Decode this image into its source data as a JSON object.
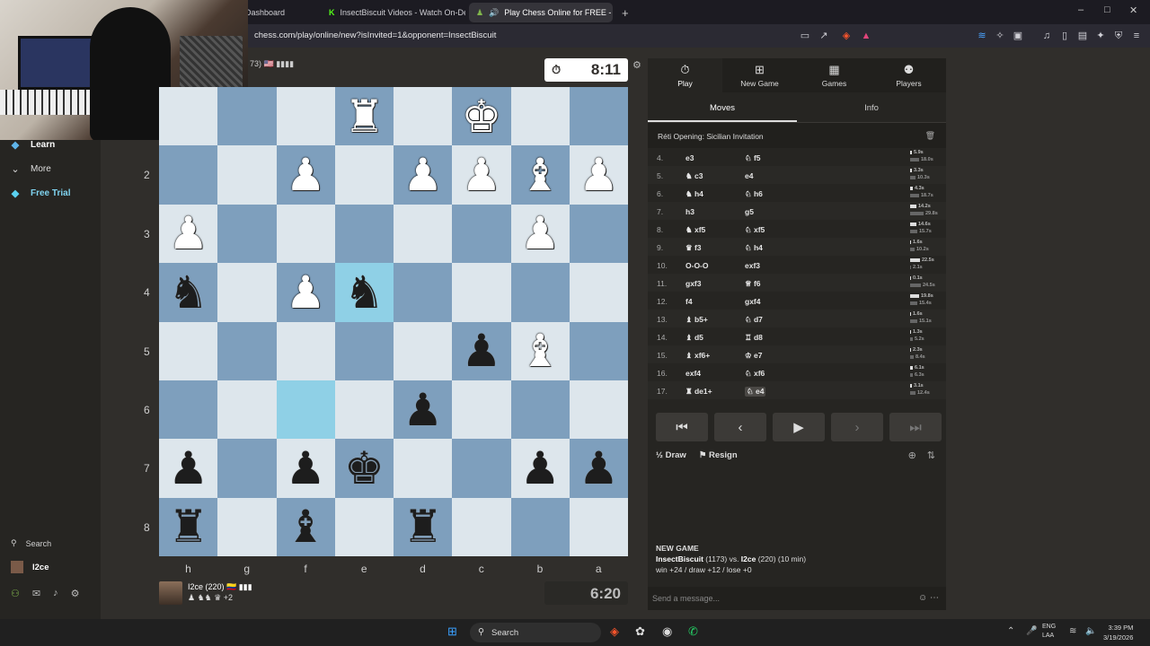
{
  "browser": {
    "tabs": [
      {
        "label": "Dashboard",
        "active": false
      },
      {
        "label": "InsectBiscuit Videos - Watch On-Dem",
        "active": false
      },
      {
        "label": "Play Chess Online for FREE - ",
        "active": true
      }
    ],
    "new_tab_glyph": "+",
    "url": "chess.com/play/online/new?isInvited=1&opponent=InsectBiscuit",
    "window_controls": [
      "–",
      "□",
      "✕"
    ]
  },
  "sidebar": {
    "items": [
      {
        "label": "Learn",
        "icon": "learn-icon"
      },
      {
        "label": "More",
        "icon": "chevron-down-icon"
      },
      {
        "label": "Free Trial",
        "icon": "diamond-icon"
      }
    ],
    "search_label": "Search",
    "username": "I2ce"
  },
  "top_player": {
    "info": "73) 🇺🇸 ▮▮▮▮",
    "clock": "8:11"
  },
  "board": {
    "rank_labels": [
      "2",
      "3",
      "4",
      "5",
      "6",
      "7",
      "8"
    ],
    "file_labels": [
      "h",
      "g",
      "f",
      "e",
      "d",
      "c",
      "b",
      "a"
    ],
    "rows": [
      [
        "",
        "",
        "",
        "wR",
        "",
        "wK",
        "",
        ""
      ],
      [
        "",
        "",
        "wP",
        "",
        "wP",
        "wP",
        "wB",
        "wP"
      ],
      [
        "wP",
        "",
        "",
        "",
        "",
        "",
        "wP",
        ""
      ],
      [
        "bN",
        "",
        "wP",
        "bN",
        "",
        "",
        "",
        ""
      ],
      [
        "",
        "",
        "",
        "",
        "",
        "bP",
        "wB",
        ""
      ],
      [
        "",
        "",
        "",
        "",
        "bP",
        "",
        "",
        ""
      ],
      [
        "bP",
        "",
        "bP",
        "bK",
        "",
        "",
        "bP",
        "bP"
      ],
      [
        "bR",
        "",
        "bB",
        "",
        "bR",
        "",
        "",
        ""
      ]
    ],
    "highlighted": [
      "3,3",
      "5,2"
    ]
  },
  "bottom_player": {
    "name": "I2ce (220) 🇨🇴 ▮▮▮",
    "captures": "♟ ♞♞ ♛ +2",
    "clock": "6:20"
  },
  "panel": {
    "tabs": [
      {
        "label": "Play",
        "icon": "stopwatch-icon",
        "active": true
      },
      {
        "label": "New Game",
        "icon": "plus-icon",
        "active": false
      },
      {
        "label": "Games",
        "icon": "board-icon",
        "active": false
      },
      {
        "label": "Players",
        "icon": "players-icon",
        "active": false
      }
    ],
    "subtabs": [
      {
        "label": "Moves",
        "active": true
      },
      {
        "label": "Info",
        "active": false
      }
    ],
    "opening": "Réti Opening: Sicilian Invitation",
    "moves": [
      {
        "n": "4.",
        "w": "e3",
        "b": "♘ f5",
        "tw": "5.9s",
        "tb": "18.0s",
        "bw": 2,
        "bb": 10
      },
      {
        "n": "5.",
        "w": "♞ c3",
        "b": "e4",
        "tw": "3.3s",
        "tb": "10.3s",
        "bw": 2,
        "bb": 6
      },
      {
        "n": "6.",
        "w": "♞ h4",
        "b": "♘ h6",
        "tw": "4.3s",
        "tb": "18.7s",
        "bw": 3,
        "bb": 10
      },
      {
        "n": "7.",
        "w": "h3",
        "b": "g5",
        "tw": "14.2s",
        "tb": "29.8s",
        "bw": 7,
        "bb": 15
      },
      {
        "n": "8.",
        "w": "♞ xf5",
        "b": "♘ xf5",
        "tw": "14.6s",
        "tb": "15.7s",
        "bw": 7,
        "bb": 8
      },
      {
        "n": "9.",
        "w": "♛ f3",
        "b": "♘ h4",
        "tw": "1.6s",
        "tb": "10.2s",
        "bw": 1,
        "bb": 5
      },
      {
        "n": "10.",
        "w": "O-O-O",
        "b": "exf3",
        "tw": "22.5s",
        "tb": "2.1s",
        "bw": 11,
        "bb": 1
      },
      {
        "n": "11.",
        "w": "gxf3",
        "b": "♕ f6",
        "tw": "0.1s",
        "tb": "24.5s",
        "bw": 1,
        "bb": 12
      },
      {
        "n": "12.",
        "w": "f4",
        "b": "gxf4",
        "tw": "19.8s",
        "tb": "15.4s",
        "bw": 10,
        "bb": 8
      },
      {
        "n": "13.",
        "w": "♝ b5+",
        "b": "♘ d7",
        "tw": "1.6s",
        "tb": "15.1s",
        "bw": 1,
        "bb": 8
      },
      {
        "n": "14.",
        "w": "♝ d5",
        "b": "♖ d8",
        "tw": "1.3s",
        "tb": "5.2s",
        "bw": 1,
        "bb": 3
      },
      {
        "n": "15.",
        "w": "♝ xf6+",
        "b": "♔ e7",
        "tw": "2.3s",
        "tb": "8.4s",
        "bw": 1,
        "bb": 4
      },
      {
        "n": "16.",
        "w": "exf4",
        "b": "♘ xf6",
        "tw": "6.1s",
        "tb": "6.3s",
        "bw": 3,
        "bb": 3
      },
      {
        "n": "17.",
        "w": "♜ de1+",
        "b": "♘ e4",
        "tw": "3.1s",
        "tb": "12.4s",
        "bw": 2,
        "bb": 6
      }
    ],
    "nav": [
      "⏮",
      "‹",
      "▶",
      "›",
      "⏭"
    ],
    "draw_label": "Draw",
    "resign_label": "Resign",
    "new_game_heading": "NEW GAME",
    "new_game_line1_a": "InsectBiscuit",
    "new_game_line1_b": " (1173) vs. ",
    "new_game_line1_c": "I2ce",
    "new_game_line1_d": " (220) (10 min)",
    "new_game_line2": "win +24 / draw +12 / lose +0",
    "chat_placeholder": "Send a message..."
  },
  "taskbar": {
    "search_label": "Search",
    "lang": "ENG",
    "lang2": "LAA",
    "time": "3:39 PM",
    "date": "3/19/2026"
  },
  "colors": {
    "light_square": "#dde6ec",
    "dark_square": "#7e9fbd",
    "highlight": "#8fd0e6",
    "panel_bg": "#262522",
    "page_bg": "#302e2b"
  }
}
